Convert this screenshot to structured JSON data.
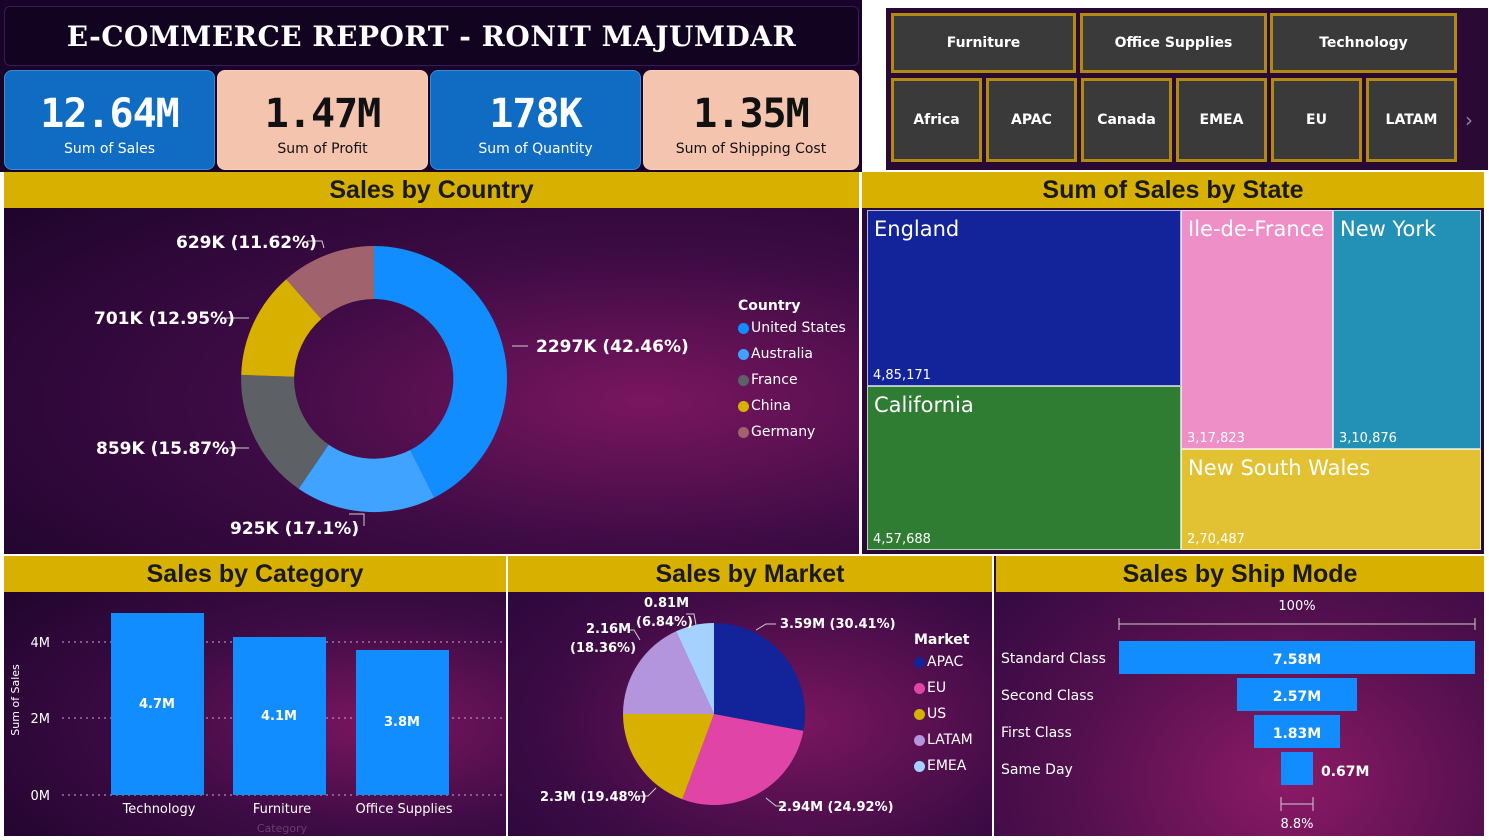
{
  "title": "E-COMMERCE REPORT - RONIT MAJUMDAR",
  "kpis": [
    {
      "value": "12.64M",
      "label": "Sum of Sales"
    },
    {
      "value": "1.47M",
      "label": "Sum of Profit"
    },
    {
      "value": "178K",
      "label": "Sum of Quantity"
    },
    {
      "value": "1.35M",
      "label": "Sum of Shipping Cost"
    }
  ],
  "slicers": {
    "category": [
      "Furniture",
      "Office Supplies",
      "Technology"
    ],
    "market": [
      "Africa",
      "APAC",
      "Canada",
      "EMEA",
      "EU",
      "LATAM"
    ],
    "more_icon": "chevron-right-icon"
  },
  "colors": {
    "accent": "#d8b000",
    "kpi_blue": "#0f6cc2",
    "kpi_peach": "#f4c4ae",
    "bar_blue": "#118dff"
  },
  "country_chart": {
    "header": "Sales by Country",
    "legend_title": "Country",
    "slices": [
      {
        "name": "United States",
        "label": "2297K (42.46%)",
        "color": "#118dff"
      },
      {
        "name": "Australia",
        "label": "925K (17.1%)",
        "color": "#3fa3ff"
      },
      {
        "name": "France",
        "label": "859K (15.87%)",
        "color": "#5d6166"
      },
      {
        "name": "China",
        "label": "701K (12.95%)",
        "color": "#d8b000"
      },
      {
        "name": "Germany",
        "label": "629K (11.62%)",
        "color": "#a0636e"
      }
    ]
  },
  "state_chart": {
    "header": "Sum of Sales by State",
    "cells": [
      {
        "name": "England",
        "value": "4,85,171",
        "color": "#13239a"
      },
      {
        "name": "California",
        "value": "4,57,688",
        "color": "#2f7d32"
      },
      {
        "name": "Ile-de-France",
        "value": "3,17,823",
        "color": "#ee8fc8"
      },
      {
        "name": "New York",
        "value": "3,10,876",
        "color": "#2391b5"
      },
      {
        "name": "New South Wales",
        "value": "2,70,487",
        "color": "#e2c233"
      }
    ]
  },
  "category_chart": {
    "header": "Sales by Category",
    "ylabel": "Sum of Sales",
    "xlabel": "Category",
    "yticks": [
      "4M",
      "2M",
      "0M"
    ],
    "bars": [
      {
        "name": "Technology",
        "label": "4.7M"
      },
      {
        "name": "Furniture",
        "label": "4.1M"
      },
      {
        "name": "Office Supplies",
        "label": "3.8M"
      }
    ]
  },
  "market_chart": {
    "header": "Sales by Market",
    "legend_title": "Market",
    "legend": [
      {
        "name": "APAC",
        "color": "#13239a"
      },
      {
        "name": "EU",
        "color": "#e044a7"
      },
      {
        "name": "US",
        "color": "#d8b000"
      },
      {
        "name": "LATAM",
        "color": "#b295dc"
      },
      {
        "name": "EMEA",
        "color": "#a4d1ff"
      }
    ],
    "labels": {
      "apac": "3.59M (30.41%)",
      "eu": "2.94M (24.92%)",
      "us": "2.3M (19.48%)",
      "latam_1": "2.16M",
      "latam_2": "(18.36%)",
      "emea_1": "0.81M",
      "emea_2": "(6.84%)"
    }
  },
  "shipmode_chart": {
    "header": "Sales by Ship Mode",
    "top_label": "100%",
    "bottom_label": "8.8%",
    "rows": [
      {
        "name": "Standard Class",
        "label": "7.58M"
      },
      {
        "name": "Second Class",
        "label": "2.57M"
      },
      {
        "name": "First Class",
        "label": "1.83M"
      },
      {
        "name": "Same Day",
        "label": "0.67M"
      }
    ]
  },
  "chart_data": [
    {
      "type": "pie",
      "title": "Sales by Country",
      "categories": [
        "United States",
        "Australia",
        "France",
        "China",
        "Germany"
      ],
      "values": [
        2297,
        925,
        859,
        701,
        629
      ],
      "percent": [
        42.46,
        17.1,
        15.87,
        12.95,
        11.62
      ],
      "donut": true,
      "legend": "right"
    },
    {
      "type": "heatmap",
      "title": "Sum of Sales by State",
      "categories": [
        "England",
        "California",
        "Ile-de-France",
        "New York",
        "New South Wales"
      ],
      "values": [
        485171,
        457688,
        317823,
        310876,
        270487
      ]
    },
    {
      "type": "bar",
      "title": "Sales by Category",
      "categories": [
        "Technology",
        "Furniture",
        "Office Supplies"
      ],
      "values": [
        4.7,
        4.1,
        3.8
      ],
      "xlabel": "Category",
      "ylabel": "Sum of Sales",
      "ylim": [
        0,
        4.7
      ],
      "grid": true
    },
    {
      "type": "pie",
      "title": "Sales by Market",
      "categories": [
        "APAC",
        "EU",
        "US",
        "LATAM",
        "EMEA"
      ],
      "values": [
        3.59,
        2.94,
        2.3,
        2.16,
        0.81
      ],
      "percent": [
        30.41,
        24.92,
        19.48,
        18.36,
        6.84
      ],
      "legend": "right"
    },
    {
      "type": "bar",
      "title": "Sales by Ship Mode",
      "categories": [
        "Standard Class",
        "Second Class",
        "First Class",
        "Same Day"
      ],
      "values": [
        7.58,
        2.57,
        1.83,
        0.67
      ],
      "orientation": "funnel"
    }
  ]
}
